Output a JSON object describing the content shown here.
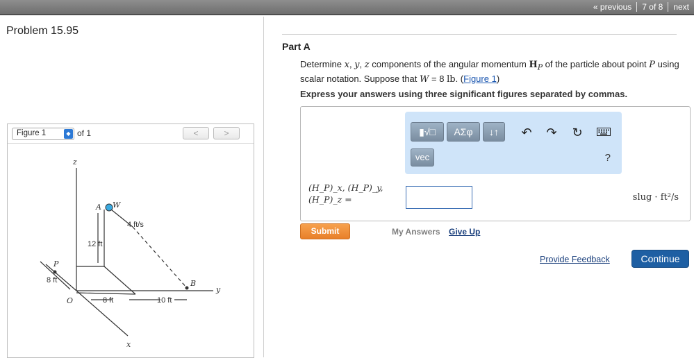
{
  "nav": {
    "previous": "« previous",
    "position": "7 of 8",
    "next": "next"
  },
  "problem": {
    "title": "Problem 15.95"
  },
  "figure": {
    "selected": "Figure 1",
    "of_label": "of 1",
    "prev_glyph": "<",
    "next_glyph": ">",
    "labels": {
      "z": "z",
      "y": "y",
      "x": "x",
      "A": "A",
      "W": "W",
      "P": "P",
      "O": "O",
      "B": "B",
      "velocity": "4 ft/s",
      "height": "12 ft",
      "p_offset": "8 ft",
      "ox": "8 ft",
      "ob": "10 ft"
    }
  },
  "part": {
    "label": "Part A",
    "q_prefix": "Determine",
    "q_x": "x",
    "q_y": "y",
    "q_z": "z",
    "q_mid": "components of the angular momentum",
    "q_H": "H",
    "q_Hsub": "P",
    "q_mid2": "of the particle about point",
    "q_P": "P",
    "q_mid3": "using scalar notation. Suppose that",
    "q_W": "W",
    "q_eq": "= 8",
    "q_unit": "lb",
    "q_fig_link": "Figure 1",
    "instruction": "Express your answers using three significant figures separated by commas."
  },
  "toolbar": {
    "templates_icon": "template-icon",
    "templates_label": "▮√□",
    "greek_label": "ΑΣφ",
    "arrows_label": "↓↑",
    "undo_icon": "undo-icon",
    "redo_icon": "redo-icon",
    "reset_icon": "reset-icon",
    "keyboard_icon": "keyboard-icon",
    "vec_label": "vec",
    "help_label": "?"
  },
  "answer": {
    "label_line1": "(H_P)_x, (H_P)_y,",
    "label_line2": "(H_P)_z =",
    "value": "",
    "units": "slug · ft²/s"
  },
  "actions": {
    "submit": "Submit",
    "my_answers": "My Answers",
    "give_up": "Give Up",
    "feedback": "Provide Feedback",
    "continue": "Continue"
  }
}
